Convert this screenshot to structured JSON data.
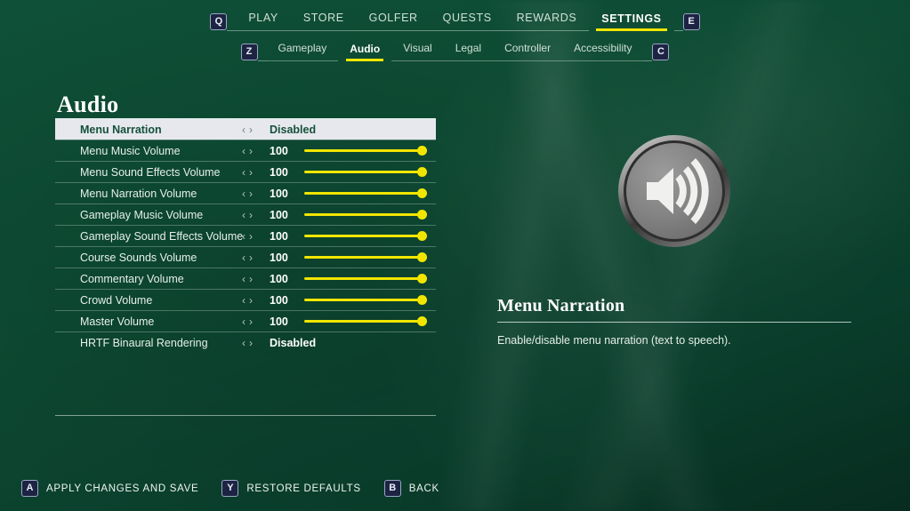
{
  "topnav": {
    "left_key": "Q",
    "right_key": "E",
    "items": [
      {
        "label": "PLAY",
        "active": false
      },
      {
        "label": "STORE",
        "active": false
      },
      {
        "label": "GOLFER",
        "active": false
      },
      {
        "label": "QUESTS",
        "active": false
      },
      {
        "label": "REWARDS",
        "active": false
      },
      {
        "label": "SETTINGS",
        "active": true
      }
    ]
  },
  "subnav": {
    "left_key": "Z",
    "right_key": "C",
    "items": [
      {
        "label": "Gameplay",
        "active": false
      },
      {
        "label": "Audio",
        "active": true
      },
      {
        "label": "Visual",
        "active": false
      },
      {
        "label": "Legal",
        "active": false
      },
      {
        "label": "Controller",
        "active": false
      },
      {
        "label": "Accessibility",
        "active": false
      }
    ]
  },
  "page": {
    "title": "Audio"
  },
  "settings": {
    "arrow_left": "‹",
    "arrow_right": "›",
    "rows": [
      {
        "label": "Menu Narration",
        "value": "Disabled",
        "slider": false,
        "percent": 0,
        "selected": true
      },
      {
        "label": "Menu Music Volume",
        "value": "100",
        "slider": true,
        "percent": 100,
        "selected": false
      },
      {
        "label": "Menu Sound Effects Volume",
        "value": "100",
        "slider": true,
        "percent": 100,
        "selected": false
      },
      {
        "label": "Menu Narration Volume",
        "value": "100",
        "slider": true,
        "percent": 100,
        "selected": false
      },
      {
        "label": "Gameplay Music Volume",
        "value": "100",
        "slider": true,
        "percent": 100,
        "selected": false
      },
      {
        "label": "Gameplay Sound Effects Volume",
        "value": "100",
        "slider": true,
        "percent": 100,
        "selected": false
      },
      {
        "label": "Course Sounds Volume",
        "value": "100",
        "slider": true,
        "percent": 100,
        "selected": false
      },
      {
        "label": "Commentary Volume",
        "value": "100",
        "slider": true,
        "percent": 100,
        "selected": false
      },
      {
        "label": "Crowd Volume",
        "value": "100",
        "slider": true,
        "percent": 100,
        "selected": false
      },
      {
        "label": "Master Volume",
        "value": "100",
        "slider": true,
        "percent": 100,
        "selected": false
      },
      {
        "label": "HRTF Binaural Rendering",
        "value": "Disabled",
        "slider": false,
        "percent": 0,
        "selected": false
      }
    ]
  },
  "detail": {
    "icon": "speaker-volume-icon",
    "title": "Menu Narration",
    "description": "Enable/disable menu narration (text to speech)."
  },
  "footer": {
    "actions": [
      {
        "key": "A",
        "label": "APPLY CHANGES AND SAVE"
      },
      {
        "key": "Y",
        "label": "RESTORE DEFAULTS"
      },
      {
        "key": "B",
        "label": "BACK"
      }
    ]
  },
  "colors": {
    "background": "#0d4a33",
    "accent_yellow": "#f2e600",
    "selected_row_bg": "#e7e8ee",
    "selected_row_text": "#14503a",
    "key_badge_bg": "#1d2342"
  }
}
